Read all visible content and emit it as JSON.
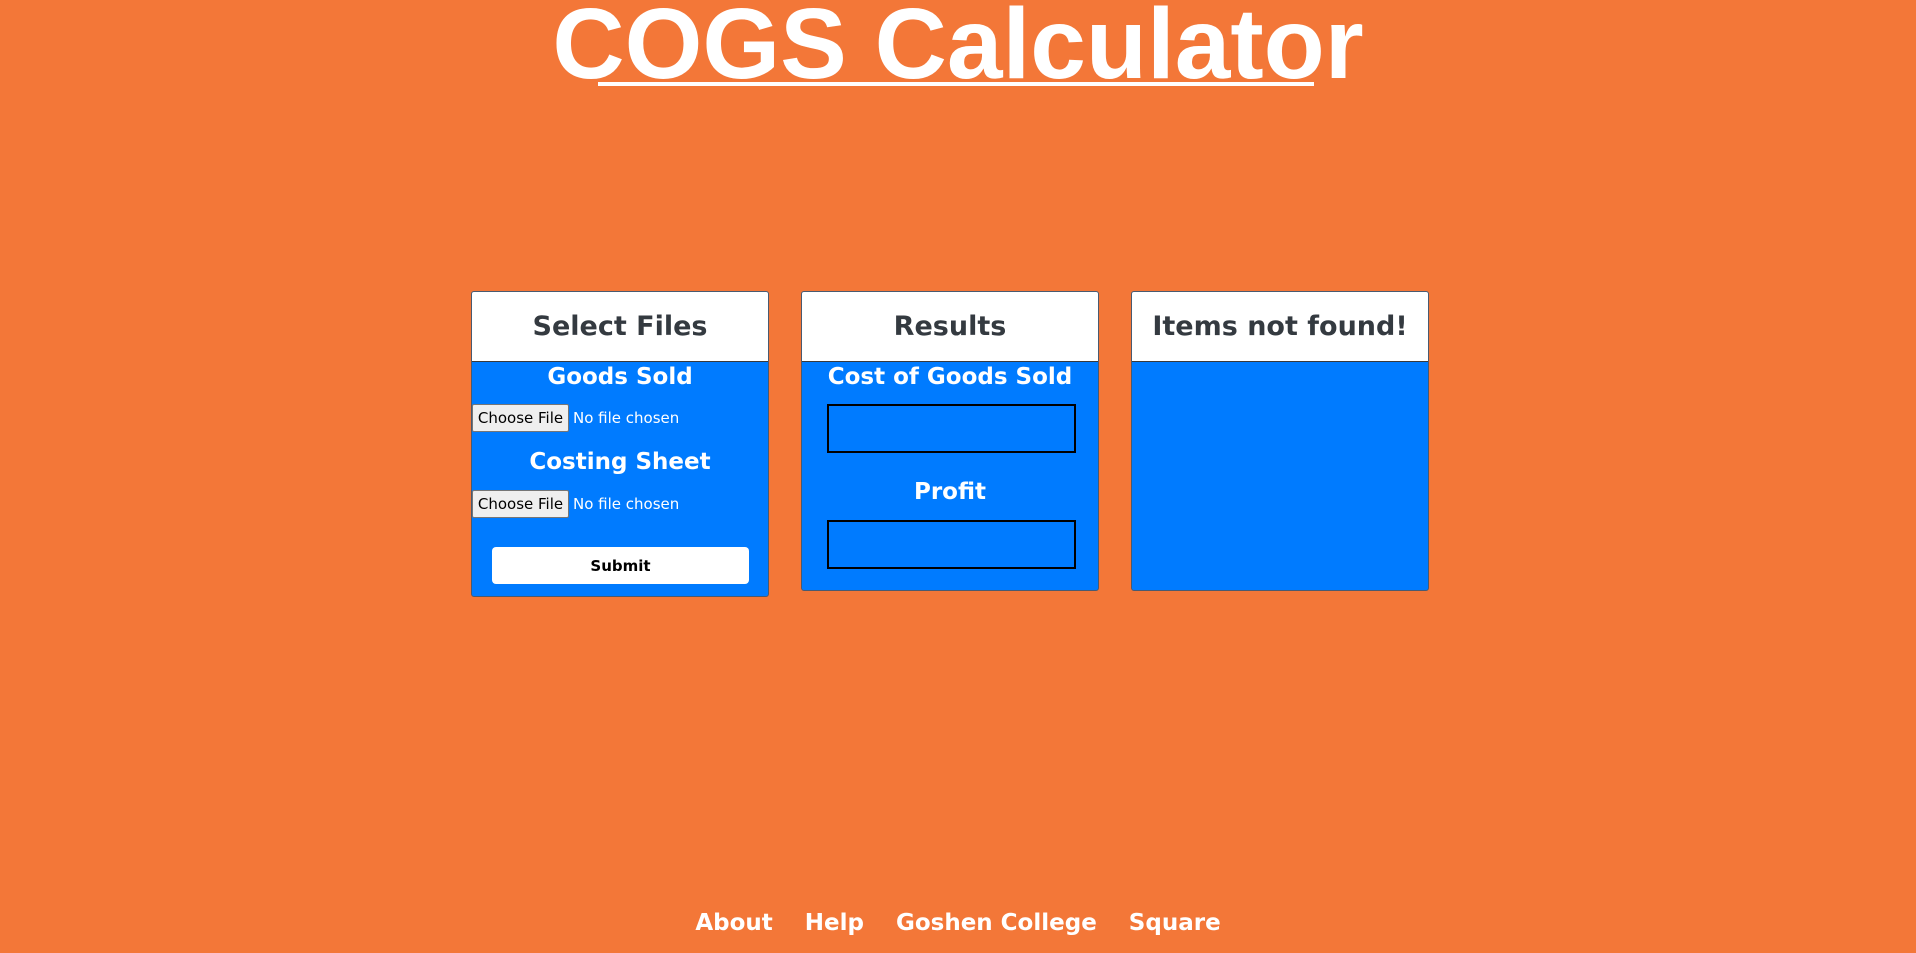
{
  "header": {
    "title": "COGS Calculator"
  },
  "select_files": {
    "heading": "Select Files",
    "goods_sold_label": "Goods Sold",
    "costing_sheet_label": "Costing Sheet",
    "choose_file_label": "Choose File",
    "no_file_text": "No file chosen",
    "submit_label": "Submit"
  },
  "results": {
    "heading": "Results",
    "cogs_label": "Cost of Goods Sold",
    "cogs_value": "",
    "profit_label": "Profit",
    "profit_value": ""
  },
  "not_found": {
    "heading": "Items not found!"
  },
  "footer": {
    "links": [
      "About",
      "Help",
      "Goshen College",
      "Square"
    ]
  },
  "colors": {
    "background": "#F37738",
    "card_blue": "#007BFF",
    "heading_text": "#343a40"
  }
}
